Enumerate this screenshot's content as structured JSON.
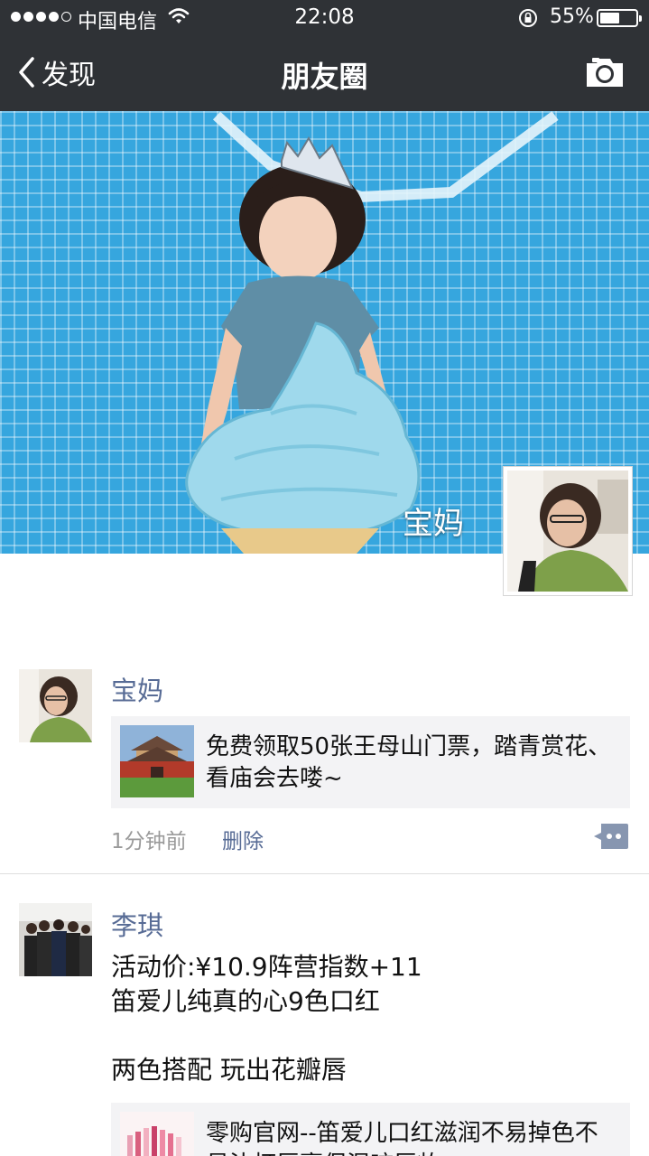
{
  "status_bar": {
    "carrier": "中国电信",
    "time": "22:08",
    "battery_percent": "55%",
    "battery_level": 0.55,
    "signal_bars": 4
  },
  "nav": {
    "back_label": "发现",
    "title": "朋友圈"
  },
  "cover": {
    "owner_name": "宝妈"
  },
  "posts": [
    {
      "author": "宝妈",
      "share": {
        "title": "免费领取50张王母山门票，踏青赏花、看庙会去喽~"
      },
      "time": "1分钟前",
      "delete_label": "删除"
    },
    {
      "author": "李琪",
      "text_lines": [
        "活动价:¥10.9阵营指数+11",
        "笛爱儿纯真的心9色口红",
        "",
        "两色搭配 玩出花瓣唇"
      ],
      "share": {
        "title": "零购官网--笛爱儿口红滋润不易掉色不易沾杯唇膏保湿咬唇妆"
      }
    }
  ],
  "colors": {
    "nav_bg": "#2f3236",
    "link_blue": "#576b95",
    "cover_blue": "#36a6de"
  }
}
